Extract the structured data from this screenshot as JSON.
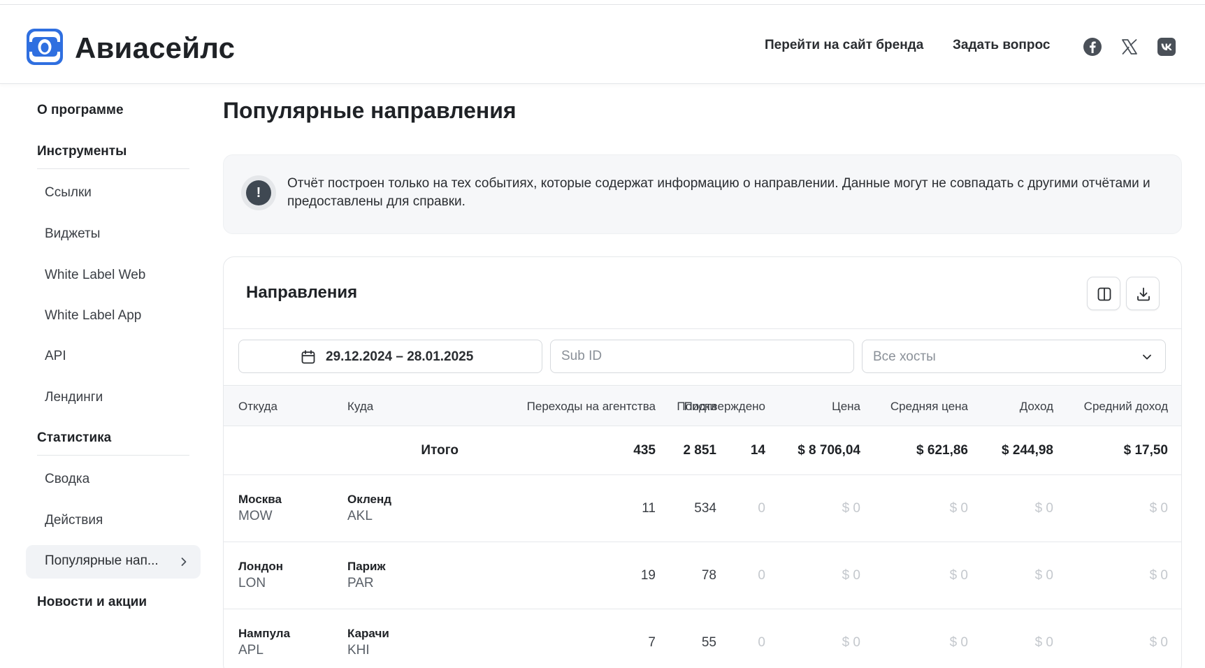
{
  "header": {
    "brand_name": "Авиасейлс",
    "links": [
      {
        "label": "Перейти на сайт бренда"
      },
      {
        "label": "Задать вопрос"
      }
    ],
    "social_icons": [
      "facebook-icon",
      "x-icon",
      "vk-icon"
    ]
  },
  "sidebar": {
    "about": "О программе",
    "tools_section": "Инструменты",
    "tools_items": [
      "Ссылки",
      "Виджеты",
      "White Label Web",
      "White Label App",
      "API",
      "Лендинги"
    ],
    "stats_section": "Статистика",
    "stats_items": [
      "Сводка",
      "Действия"
    ],
    "active_item": "Популярные нап...",
    "news": "Новости и акции"
  },
  "page": {
    "title": "Популярные направления",
    "notice_icon": "!",
    "notice_text": "Отчёт построен только на тех событиях, которые содержат информацию о направлении. Данные могут не совпадать с другими отчётами и предоставлены для справки."
  },
  "card": {
    "title": "Направления",
    "filters": {
      "date_range": "29.12.2024 – 28.01.2025",
      "subid_placeholder": "Sub ID",
      "hosts_value": "Все хосты"
    },
    "columns": [
      "Откуда",
      "Куда",
      "Поиски",
      "Переходы на агентства",
      "Подтверждено",
      "Цена",
      "Средняя цена",
      "Доход",
      "Средний доход"
    ],
    "total": {
      "label": "Итого",
      "searches": "2 851",
      "clicks": "435",
      "confirmed": "14",
      "price": "$ 8 706,04",
      "avg_price": "$ 621,86",
      "income": "$ 244,98",
      "avg_income": "$ 17,50"
    },
    "rows": [
      {
        "from_city": "Москва",
        "from_code": "MOW",
        "to_city": "Окленд",
        "to_code": "AKL",
        "searches": "534",
        "clicks": "11",
        "confirmed": "0",
        "price": "$ 0",
        "avg_price": "$ 0",
        "income": "$ 0",
        "avg_income": "$ 0"
      },
      {
        "from_city": "Лондон",
        "from_code": "LON",
        "to_city": "Париж",
        "to_code": "PAR",
        "searches": "78",
        "clicks": "19",
        "confirmed": "0",
        "price": "$ 0",
        "avg_price": "$ 0",
        "income": "$ 0",
        "avg_income": "$ 0"
      },
      {
        "from_city": "Нампула",
        "from_code": "APL",
        "to_city": "Карачи",
        "to_code": "KHI",
        "searches": "55",
        "clicks": "7",
        "confirmed": "0",
        "price": "$ 0",
        "avg_price": "$ 0",
        "income": "$ 0",
        "avg_income": "$ 0"
      }
    ]
  }
}
